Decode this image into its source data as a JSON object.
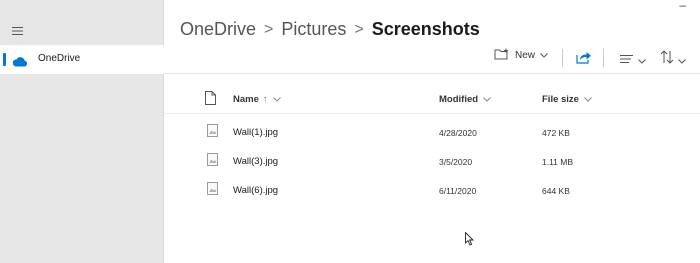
{
  "window": {
    "minimize_glyph": "–"
  },
  "sidebar": {
    "items": [
      {
        "label": "OneDrive",
        "icon": "cloud-icon",
        "selected": true
      }
    ]
  },
  "breadcrumb": {
    "parts": [
      "OneDrive",
      "Pictures"
    ],
    "separator": ">",
    "current": "Screenshots"
  },
  "toolbar": {
    "new_label": "New"
  },
  "columns": {
    "name": "Name",
    "name_sort": "↑",
    "modified": "Modified",
    "size": "File size"
  },
  "files": [
    {
      "name": "Wall(1).jpg",
      "modified": "4/28/2020",
      "size": "472 KB"
    },
    {
      "name": "Wall(3).jpg",
      "modified": "3/5/2020",
      "size": "1.11 MB"
    },
    {
      "name": "Wall(6).jpg",
      "modified": "6/11/2020",
      "size": "644 KB"
    }
  ],
  "colors": {
    "accent": "#0078d4",
    "sidebar_bg": "#e6e6e6"
  }
}
